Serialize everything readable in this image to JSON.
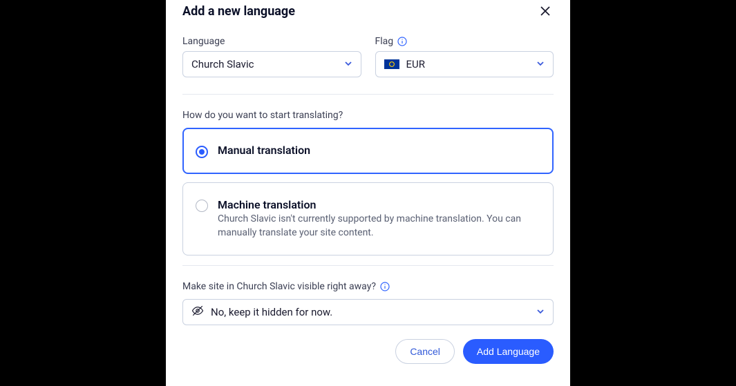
{
  "modal": {
    "title": "Add a new language",
    "language": {
      "label": "Language",
      "value": "Church Slavic"
    },
    "flag": {
      "label": "Flag",
      "value": "EUR"
    },
    "translation": {
      "question": "How do you want to start translating?",
      "manual": {
        "title": "Manual translation"
      },
      "machine": {
        "title": "Machine translation",
        "description": "Church Slavic isn't currently supported by machine translation. You can manually translate your site content."
      }
    },
    "visibility": {
      "question": "Make site in Church Slavic visible right away?",
      "value": "No, keep it hidden for now."
    },
    "actions": {
      "cancel": "Cancel",
      "add": "Add Language"
    }
  }
}
